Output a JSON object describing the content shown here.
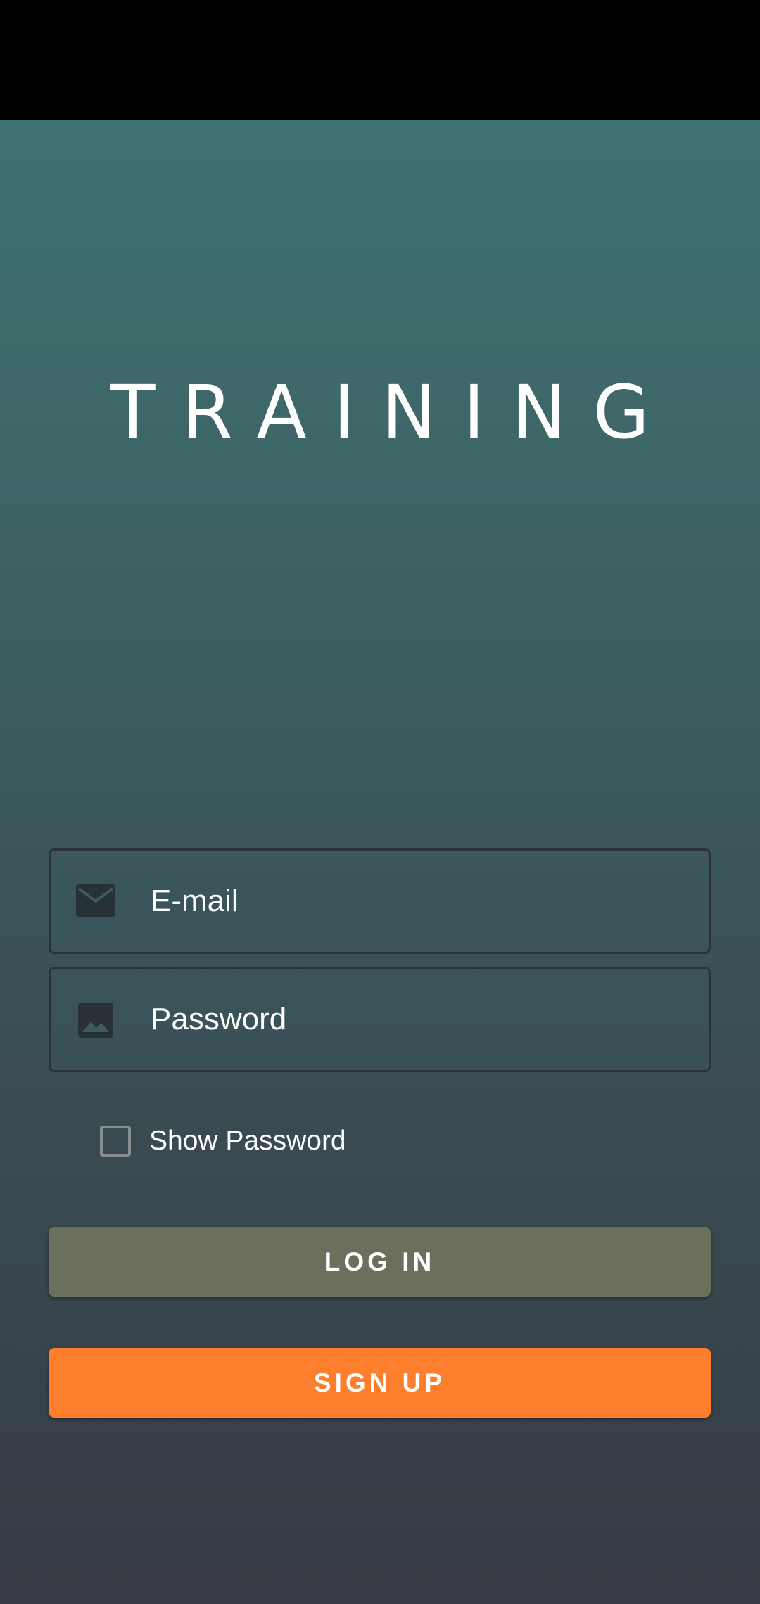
{
  "app": {
    "title": "TRAINING"
  },
  "form": {
    "email_placeholder": "E-mail",
    "password_placeholder": "Password",
    "show_password_label": "Show Password",
    "show_password_checked": false
  },
  "buttons": {
    "login_label": "LOG IN",
    "signup_label": "SIGN UP"
  },
  "icons": {
    "email": "mail-icon",
    "password": "image-icon"
  },
  "colors": {
    "login_button": "#6a705c",
    "signup_button": "#fd7f2d",
    "icon": "#283236",
    "text": "#ffffff"
  }
}
